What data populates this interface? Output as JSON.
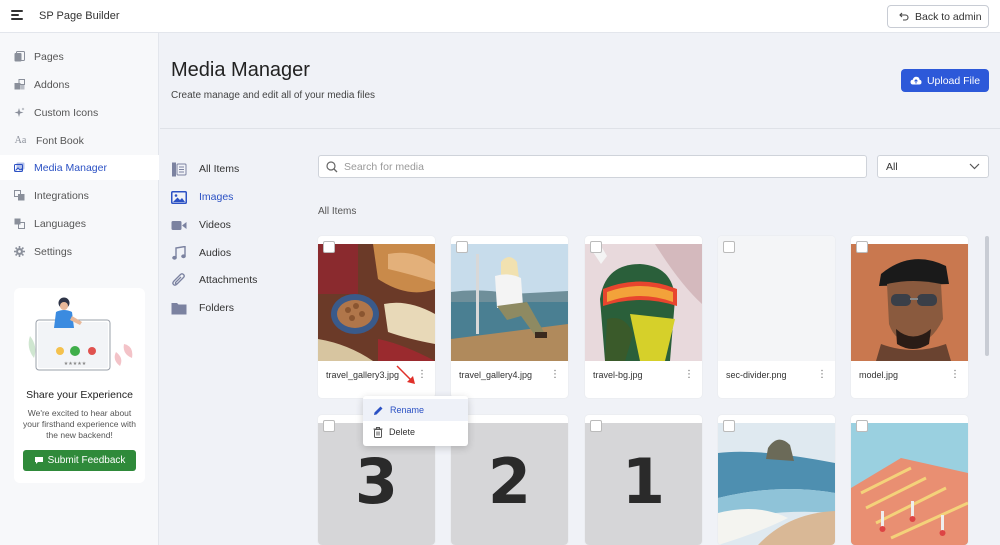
{
  "app": {
    "title": "SP Page Builder",
    "back_label": "Back to admin"
  },
  "sidebar": {
    "items": [
      {
        "label": "Pages",
        "icon": "pages-icon"
      },
      {
        "label": "Addons",
        "icon": "addons-icon"
      },
      {
        "label": "Custom Icons",
        "icon": "sparkle-icon"
      },
      {
        "label": "Font Book",
        "icon": "font-icon"
      },
      {
        "label": "Media Manager",
        "icon": "media-icon",
        "active": true
      },
      {
        "label": "Integrations",
        "icon": "integrations-icon"
      },
      {
        "label": "Languages",
        "icon": "languages-icon"
      },
      {
        "label": "Settings",
        "icon": "gear-icon"
      }
    ],
    "feedback": {
      "title": "Share your Experience",
      "text": "We're excited to hear about your firsthand experience with the new backend!",
      "button": "Submit Feedback"
    }
  },
  "header": {
    "title": "Media Manager",
    "subtitle": "Create manage and edit all of your media files",
    "upload_label": "Upload File"
  },
  "categories": [
    {
      "label": "All Items",
      "icon": "all-items-icon"
    },
    {
      "label": "Images",
      "icon": "image-icon",
      "active": true
    },
    {
      "label": "Videos",
      "icon": "video-icon"
    },
    {
      "label": "Audios",
      "icon": "audio-icon"
    },
    {
      "label": "Attachments",
      "icon": "paperclip-icon"
    },
    {
      "label": "Folders",
      "icon": "folder-icon"
    }
  ],
  "search": {
    "placeholder": "Search for media",
    "value": ""
  },
  "filter": {
    "selected": "All"
  },
  "section_label": "All Items",
  "media": [
    {
      "name": "travel_gallery3.jpg"
    },
    {
      "name": "travel_gallery4.jpg"
    },
    {
      "name": "travel-bg.jpg"
    },
    {
      "name": "sec-divider.png"
    },
    {
      "name": "model.jpg"
    },
    {
      "number": "3"
    },
    {
      "number": "2"
    },
    {
      "number": "1"
    },
    {
      "name": ""
    },
    {
      "name": ""
    }
  ],
  "context_menu": {
    "rename": "Rename",
    "delete": "Delete"
  },
  "colors": {
    "accent": "#2d59d9",
    "feedback_button": "#2f8a3a",
    "background": "#f0f2f7"
  }
}
